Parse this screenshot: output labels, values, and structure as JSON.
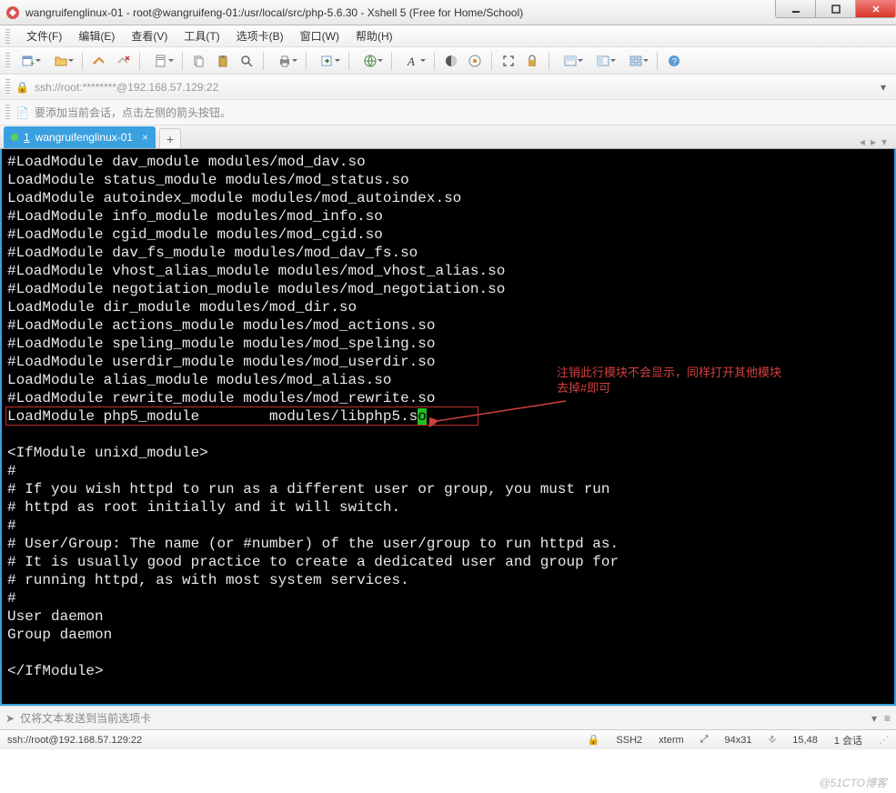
{
  "window": {
    "title": "wangruifenglinux-01 - root@wangruifeng-01:/usr/local/src/php-5.6.30 - Xshell 5 (Free for Home/School)"
  },
  "menu": {
    "items": [
      "文件(F)",
      "编辑(E)",
      "查看(V)",
      "工具(T)",
      "选项卡(B)",
      "窗口(W)",
      "帮助(H)"
    ]
  },
  "address": {
    "text": "ssh://root:********@192.168.57.129:22"
  },
  "hint": {
    "text": "要添加当前会话，点击左侧的箭头按钮。"
  },
  "tab": {
    "number": "1",
    "label": "wangruifenglinux-01"
  },
  "terminal_lines": [
    "#LoadModule dav_module modules/mod_dav.so",
    "LoadModule status_module modules/mod_status.so",
    "LoadModule autoindex_module modules/mod_autoindex.so",
    "#LoadModule info_module modules/mod_info.so",
    "#LoadModule cgid_module modules/mod_cgid.so",
    "#LoadModule dav_fs_module modules/mod_dav_fs.so",
    "#LoadModule vhost_alias_module modules/mod_vhost_alias.so",
    "#LoadModule negotiation_module modules/mod_negotiation.so",
    "LoadModule dir_module modules/mod_dir.so",
    "#LoadModule actions_module modules/mod_actions.so",
    "#LoadModule speling_module modules/mod_speling.so",
    "#LoadModule userdir_module modules/mod_userdir.so",
    "LoadModule alias_module modules/mod_alias.so",
    "#LoadModule rewrite_module modules/mod_rewrite.so",
    "LoadModule php5_module        modules/libphp5.s",
    "",
    "<IfModule unixd_module>",
    "#",
    "# If you wish httpd to run as a different user or group, you must run",
    "# httpd as root initially and it will switch.",
    "#",
    "# User/Group: The name (or #number) of the user/group to run httpd as.",
    "# It is usually good practice to create a dedicated user and group for",
    "# running httpd, as with most system services.",
    "#",
    "User daemon",
    "Group daemon",
    "",
    "</IfModule>"
  ],
  "cursor_char": "o",
  "annotation": {
    "line1": "注销此行模块不会显示，同样打开其他模块",
    "line2": "去掉#即可"
  },
  "inputbar": {
    "placeholder": "仅将文本发送到当前选项卡"
  },
  "status": {
    "left": "ssh://root@192.168.57.129:22",
    "ssh": "SSH2",
    "term": "xterm",
    "size": "94x31",
    "pos": "15,48",
    "sessions": "1 会话"
  },
  "watermark": "@51CTO博客"
}
